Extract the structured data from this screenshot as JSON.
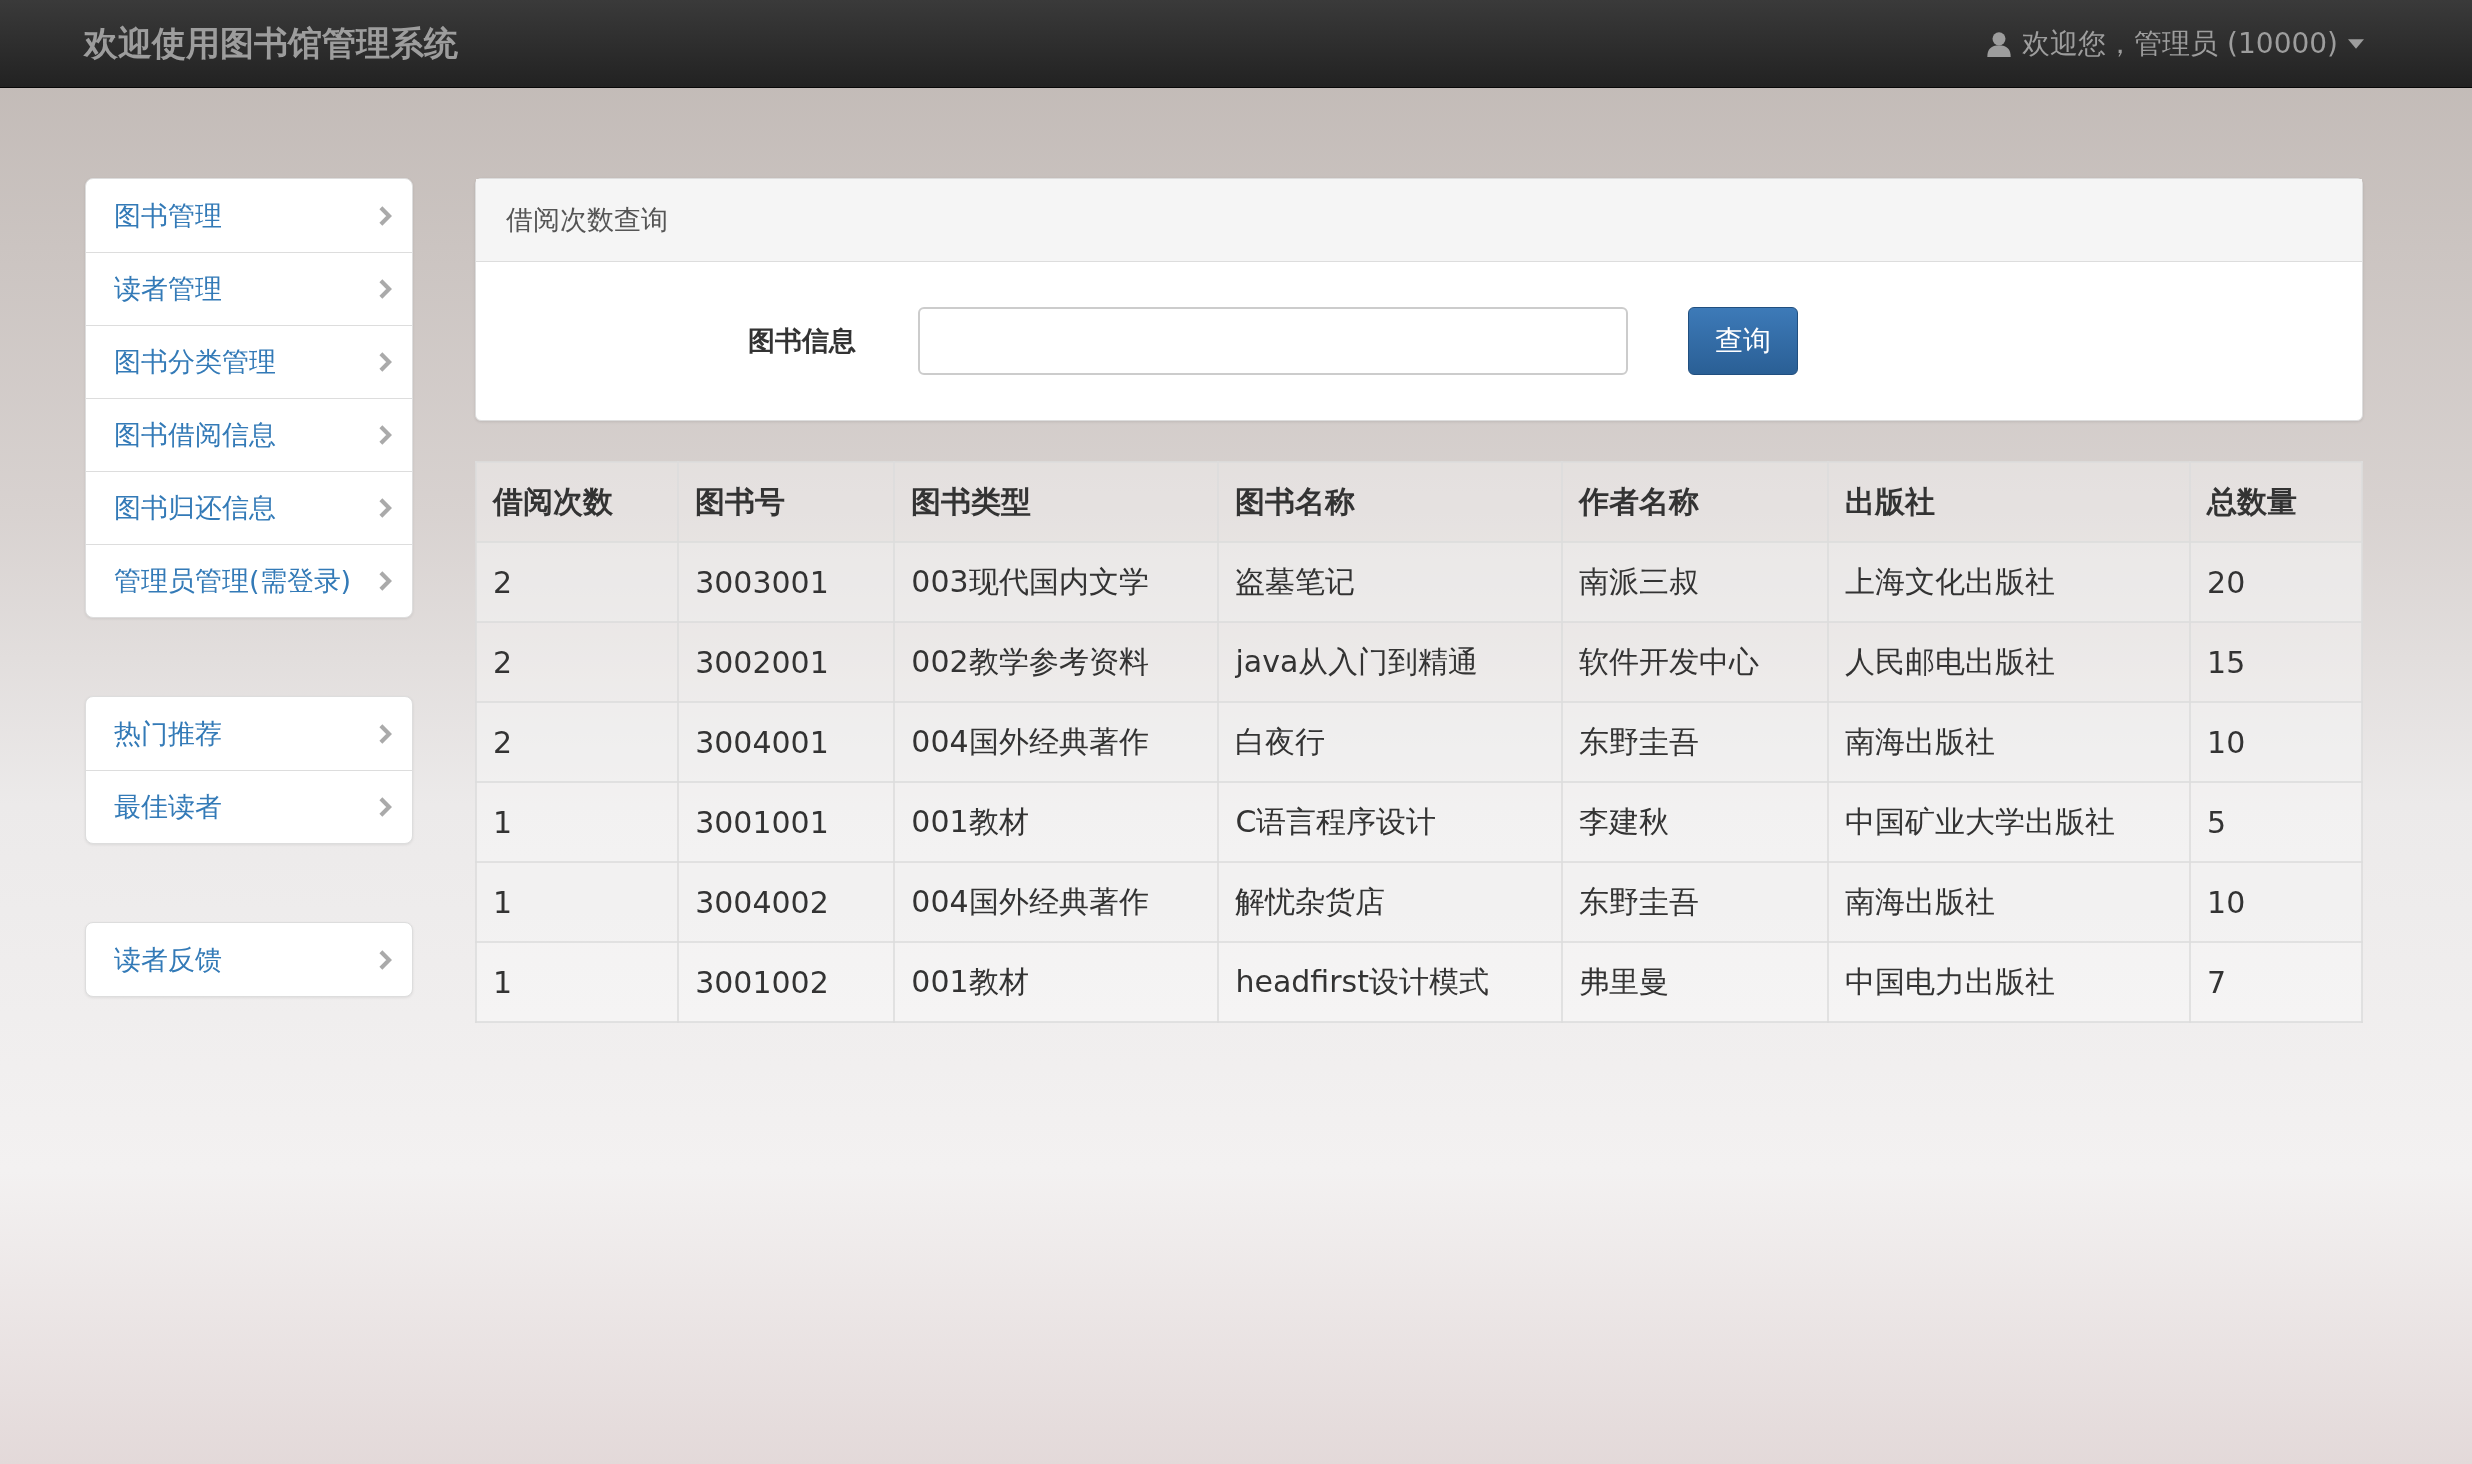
{
  "navbar": {
    "title": "欢迎使用图书馆管理系统",
    "user_menu": "欢迎您，管理员 (10000)"
  },
  "sidebar": {
    "groups": [
      {
        "items": [
          {
            "label": "图书管理"
          },
          {
            "label": "读者管理"
          },
          {
            "label": "图书分类管理"
          },
          {
            "label": "图书借阅信息"
          },
          {
            "label": "图书归还信息"
          },
          {
            "label": "管理员管理(需登录)"
          }
        ]
      },
      {
        "items": [
          {
            "label": "热门推荐"
          },
          {
            "label": "最佳读者"
          }
        ]
      },
      {
        "items": [
          {
            "label": "读者反馈"
          }
        ]
      }
    ]
  },
  "panel": {
    "title": "借阅次数查询",
    "field_label": "图书信息",
    "search_button": "查询"
  },
  "table": {
    "columns": [
      "借阅次数",
      "图书号",
      "图书类型",
      "图书名称",
      "作者名称",
      "出版社",
      "总数量"
    ],
    "rows": [
      [
        "2",
        "3003001",
        "003现代国内文学",
        "盗墓笔记",
        "南派三叔",
        "上海文化出版社",
        "20"
      ],
      [
        "2",
        "3002001",
        "002教学参考资料",
        "java从入门到精通",
        "软件开发中心",
        "人民邮电出版社",
        "15"
      ],
      [
        "2",
        "3004001",
        "004国外经典著作",
        "白夜行",
        "东野圭吾",
        "南海出版社",
        "10"
      ],
      [
        "1",
        "3001001",
        "001教材",
        "C语言程序设计",
        "李建秋",
        "中国矿业大学出版社",
        "5"
      ],
      [
        "1",
        "3004002",
        "004国外经典著作",
        "解忧杂货店",
        "东野圭吾",
        "南海出版社",
        "10"
      ],
      [
        "1",
        "3001002",
        "001教材",
        "headfirst设计模式",
        "弗里曼",
        "中国电力出版社",
        "7"
      ]
    ]
  }
}
